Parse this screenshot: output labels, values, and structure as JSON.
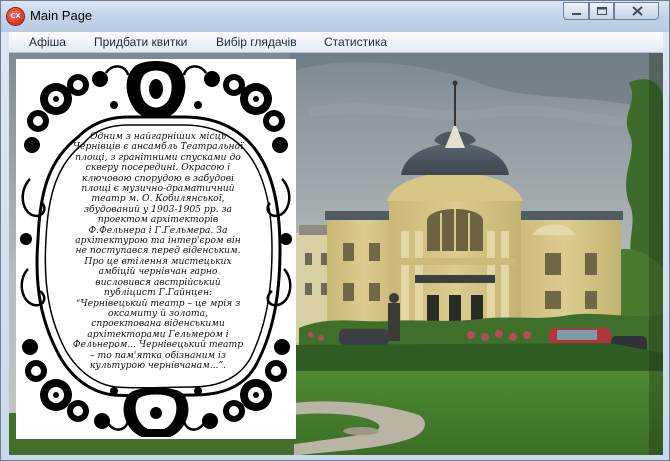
{
  "window": {
    "title": "Main Page",
    "icon_text": "CX",
    "buttons": {
      "minimize": "minimize-icon",
      "maximize": "maximize-icon",
      "close": "close-icon"
    }
  },
  "menu": {
    "items": [
      {
        "label": "Афіша"
      },
      {
        "label": "Придбати квитки"
      },
      {
        "label": "Вибір глядачів"
      },
      {
        "label": "Статистика"
      }
    ]
  },
  "content": {
    "description": "Одним з найгарніших місць Чернівців є ансамбль Театральної площі, з гранітними спусками до скверу посередині. Окрасою і ключовою спорудою в забудові площі є музично-драматичний театр м. О. Кобилянської, збудований у 1903-1905 рр. за проектом архітекторів Ф.Фельнера і Г.Гельмера. За архітектурою та інтер'єром він не поступався перед віденським. Про це втілення мистецьких амбіцій чернівчан гарно висловився австрійський публіцист Г.Гайнцен: “Чернівецький театр – це мрія з оксамиту й золота, спроектована віденськими архітекторами Гельмером і Фельнером... Чернівецький театр – то пам'ятка обізнаним із культурою чернівчанам...”.",
    "accent_colors": {
      "building": "#d6c689",
      "roof": "#4d5a63",
      "lawn": "#3f7a2a"
    }
  }
}
